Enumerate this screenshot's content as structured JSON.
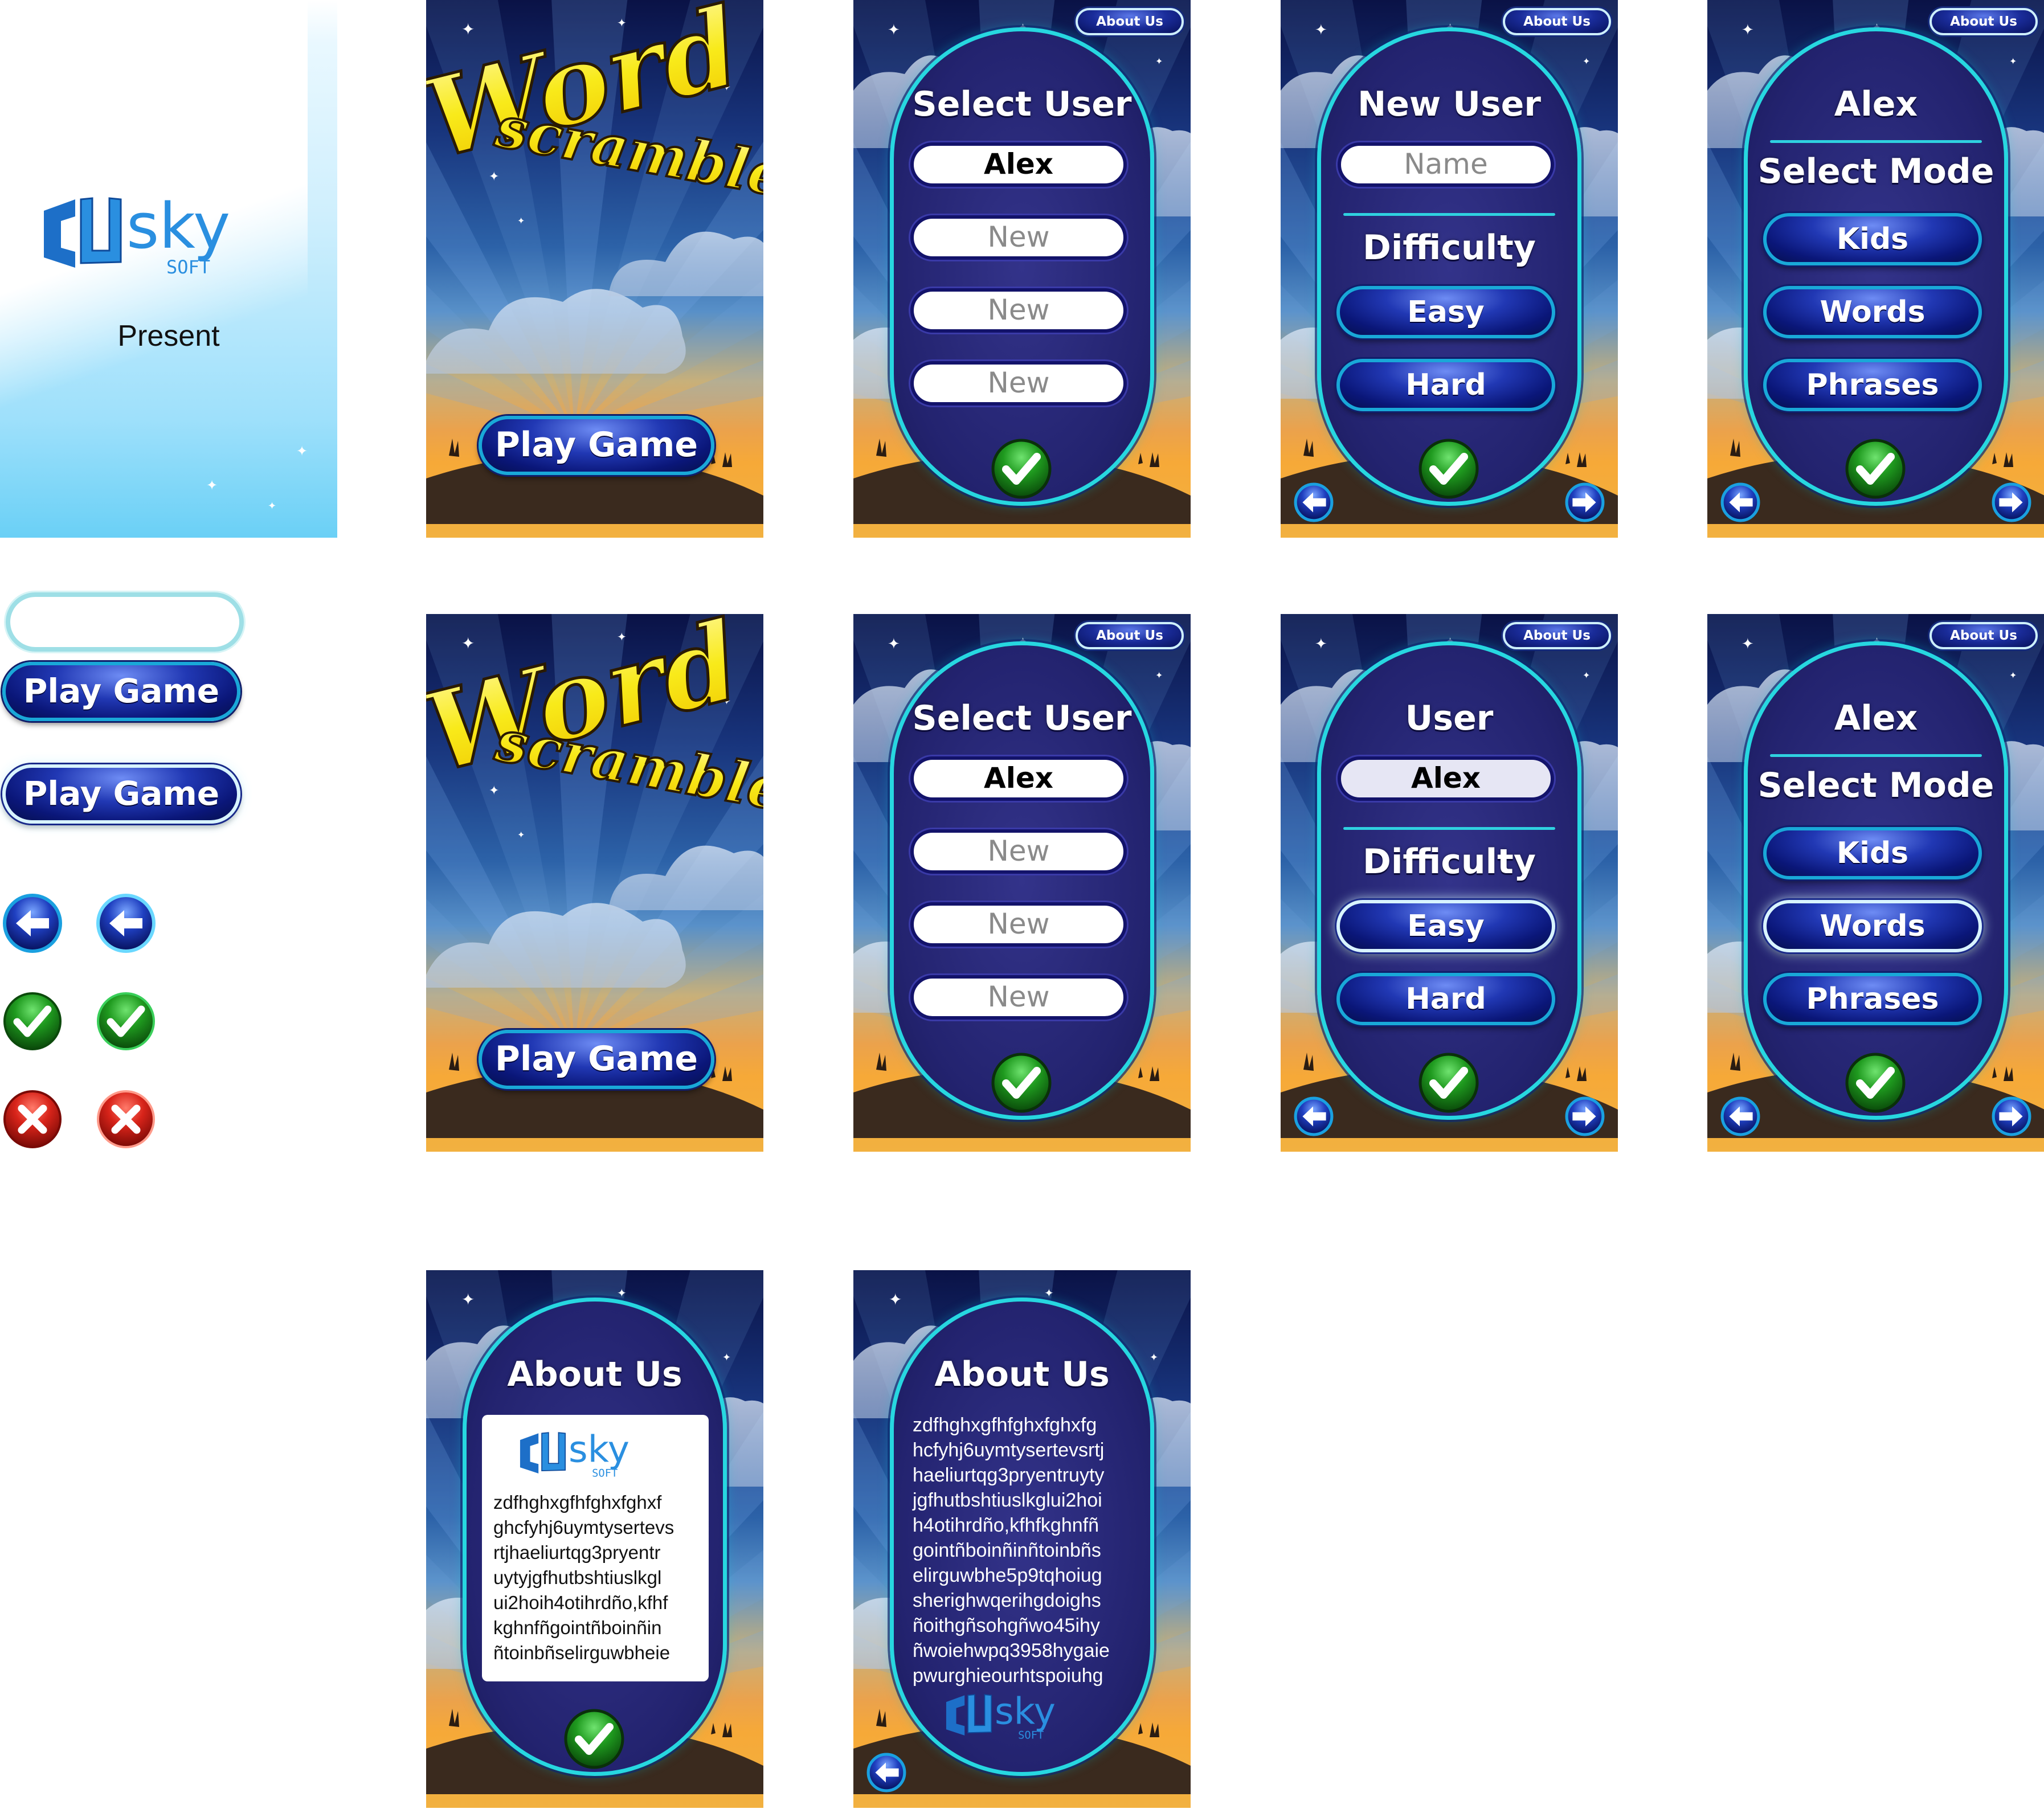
{
  "splash": {
    "present_label": "Present",
    "brand": "sky",
    "brand_sub": "SOFT"
  },
  "game_title": {
    "word": "Word",
    "scramble": "scramble"
  },
  "kit": {
    "play_game_1": "Play Game",
    "play_game_2": "Play Game"
  },
  "title_screen_1": {
    "play_button": "Play Game"
  },
  "title_screen_2": {
    "play_button": "Play Game"
  },
  "select_user_1": {
    "about_button": "About Us",
    "title": "Select User",
    "users": [
      "Alex",
      "New",
      "New",
      "New"
    ]
  },
  "select_user_2": {
    "about_button": "About Us",
    "title": "Select User",
    "users": [
      "Alex",
      "New",
      "New",
      "New"
    ]
  },
  "new_user": {
    "about_button": "About Us",
    "title": "New User",
    "name_placeholder": "Name",
    "difficulty_title": "Difficulty",
    "easy": "Easy",
    "hard": "Hard"
  },
  "user_difficulty": {
    "about_button": "About Us",
    "title": "User",
    "user_value": "Alex",
    "difficulty_title": "Difficulty",
    "easy": "Easy",
    "hard": "Hard"
  },
  "select_mode_1": {
    "about_button": "About Us",
    "user": "Alex",
    "title": "Select Mode",
    "modes": [
      "Kids",
      "Words",
      "Phrases"
    ]
  },
  "select_mode_2": {
    "about_button": "About Us",
    "user": "Alex",
    "title": "Select Mode",
    "modes": [
      "Kids",
      "Words",
      "Phrases"
    ]
  },
  "about_1": {
    "title": "About Us",
    "text": "zdfhghxgfhfghxfghxf\nghcfyhj6uymtysertevs\nrtjhaeliurtqg3pryentr\nuytyjgfhutbshtiuslkgl\nui2hoih4otihrdño,kfhf\nkghnfñgointñboinñin\nñtoinbñselirguwbheie"
  },
  "about_2": {
    "title": "About Us",
    "text": "zdfhghxgfhfghxfghxfg\nhcfyhj6uymtysertevsrtj\nhaeliurtqg3pryentruyty\njgfhutbshtiuslkglui2hoi\nh4otihrdño,kfhfkghnfñ\ngointñboinñinñtoinbñs\nelirguwbhe5p9tqhoiug\nsherighwqerihgdoighs\nñoithgñsohgñwo45ihy\nñwoiehwpq3958hygaie\npwurghieourhtspoiuhg"
  },
  "colors": {
    "capsule_border": "#27d7e0",
    "capsule_fill": "#23236f",
    "button_blue": "#0a1678",
    "check_green": "#1c8a1c",
    "close_red": "#d11a1a",
    "splash_blue": "#6ad0f6"
  },
  "icons": [
    "back-arrow-icon",
    "forward-arrow-icon",
    "check-icon",
    "close-icon",
    "star-icon",
    "cloud-icon"
  ]
}
